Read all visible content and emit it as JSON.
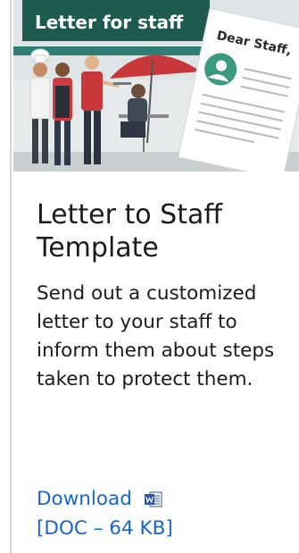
{
  "hero": {
    "banner_text": "Letter for staff",
    "letter_greeting": "Dear Staff,"
  },
  "card": {
    "title": "Letter to Staff Template",
    "description": "Send out a customized letter to your staff to inform them about steps taken to protect them.",
    "download_label": "Download",
    "file_info": "[DOC – 64 KB]",
    "file_icon": "word-document-icon"
  },
  "colors": {
    "link": "#1a66c6",
    "banner": "#1e5a50",
    "text": "#1b1b1b"
  }
}
